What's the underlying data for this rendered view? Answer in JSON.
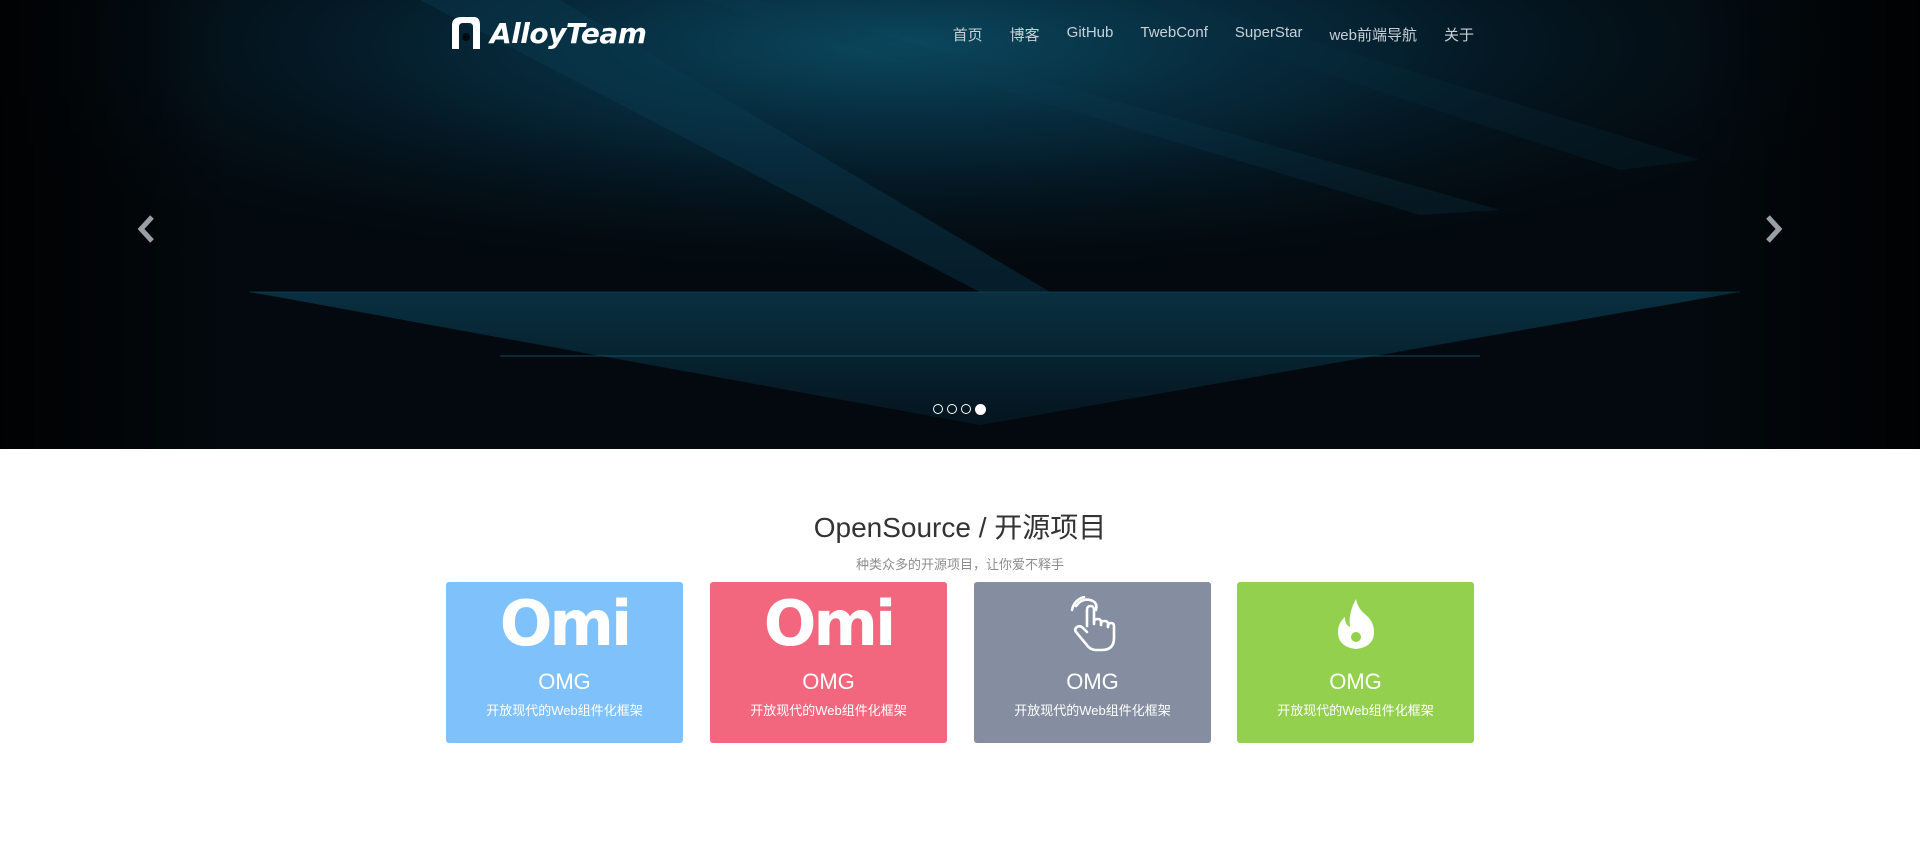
{
  "brand": {
    "name": "AlloyTeam"
  },
  "nav": {
    "items": [
      "首页",
      "博客",
      "GitHub",
      "TwebConf",
      "SuperStar",
      "web前端导航",
      "关于"
    ]
  },
  "carousel": {
    "slide_count": 4,
    "active_index": 3
  },
  "opensource": {
    "title": "OpenSource / 开源项目",
    "subtitle": "种类众多的开源项目，让你爱不释手",
    "cards": [
      {
        "icon": "omi-logo",
        "logo_text": "Omi",
        "name": "OMG",
        "desc": "开放现代的Web组件化框架",
        "color": "#7fc1fb"
      },
      {
        "icon": "omi-logo",
        "logo_text": "Omi",
        "name": "OMG",
        "desc": "开放现代的Web组件化框架",
        "color": "#f2677e"
      },
      {
        "icon": "hand-pointer-icon",
        "name": "OMG",
        "desc": "开放现代的Web组件化框架",
        "color": "#848ea0"
      },
      {
        "icon": "flame-icon",
        "name": "OMG",
        "desc": "开放现代的Web组件化框架",
        "color": "#92d04d"
      }
    ]
  },
  "colors": {
    "hero_bg": "#03090e",
    "accent_teal": "#0e4a5e"
  }
}
